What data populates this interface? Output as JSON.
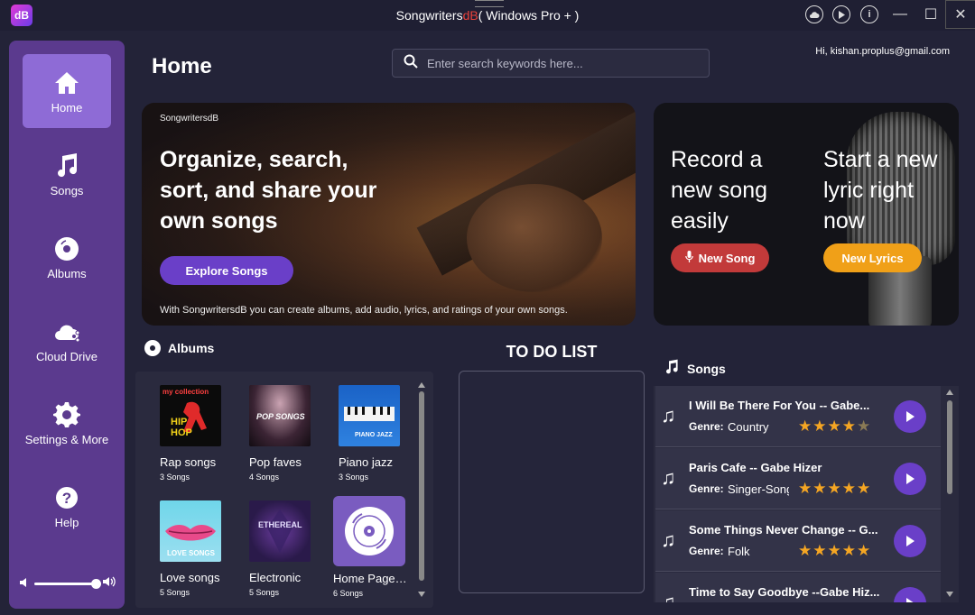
{
  "window": {
    "logo_text": "dB",
    "title_prefix": "Songwriters",
    "title_accent": "dB",
    "title_suffix": "( Windows Pro + )",
    "minimize": "—",
    "maximize": "☐",
    "close": "✕"
  },
  "sidebar": {
    "items": [
      {
        "label": "Home",
        "icon": "home-icon",
        "active": true
      },
      {
        "label": "Songs",
        "icon": "music-note-icon"
      },
      {
        "label": "Albums",
        "icon": "album-disc-icon"
      },
      {
        "label": "Cloud Drive",
        "icon": "cloud-share-icon"
      },
      {
        "label": "Settings & More",
        "icon": "gear-icon"
      },
      {
        "label": "Help",
        "icon": "help-icon"
      }
    ],
    "volume_level": 0.92
  },
  "header": {
    "page_title": "Home",
    "search_placeholder": "Enter search keywords here...",
    "greeting": "Hi, kishan.proplus@gmail.com"
  },
  "hero": {
    "brand": "SongwritersdB",
    "headline": "Organize, search, sort, and share your own songs",
    "button": "Explore Songs",
    "caption": "With SongwritersdB you can create albums, add audio, lyrics, and ratings of your own songs."
  },
  "record": {
    "left_text": "Record a new song easily",
    "left_button": "New Song",
    "right_text": "Start a new lyric right now",
    "right_button": "New Lyrics"
  },
  "albums": {
    "heading": "Albums",
    "items": [
      {
        "name": "Rap songs",
        "count": "3 Songs",
        "cover_text": "my collection"
      },
      {
        "name": "Pop faves",
        "count": "4 Songs",
        "cover_text": "POP SONGS"
      },
      {
        "name": "Piano jazz",
        "count": "3 Songs",
        "cover_text": "PIANO JAZZ"
      },
      {
        "name": "Love songs",
        "count": "5 Songs",
        "cover_text": "LOVE SONGS"
      },
      {
        "name": "Electronic",
        "count": "5 Songs",
        "cover_text": "ETHEREAL"
      },
      {
        "name": "Home Page S...",
        "count": "6 Songs",
        "cover_text": ""
      }
    ]
  },
  "todo": {
    "title": "TO DO LIST"
  },
  "songs": {
    "heading": "Songs",
    "genre_label": "Genre:",
    "items": [
      {
        "title": "I Will Be There For You -- Gabe...",
        "genre": "Country",
        "rating": 4
      },
      {
        "title": "Paris Cafe -- Gabe Hizer",
        "genre": "Singer-Song",
        "rating": 5
      },
      {
        "title": "Some Things Never Change -- G...",
        "genre": "Folk",
        "rating": 5
      },
      {
        "title": "Time to Say Goodbye --Gabe Hiz...",
        "genre": "",
        "rating": 0
      }
    ]
  },
  "colors": {
    "sidebar": "#5b3a8e",
    "active_nav": "#8e6bd6",
    "primary_button": "#6a3fc8",
    "new_song": "#c23a3a",
    "new_lyrics": "#f0a018",
    "star": "#f5a623"
  }
}
